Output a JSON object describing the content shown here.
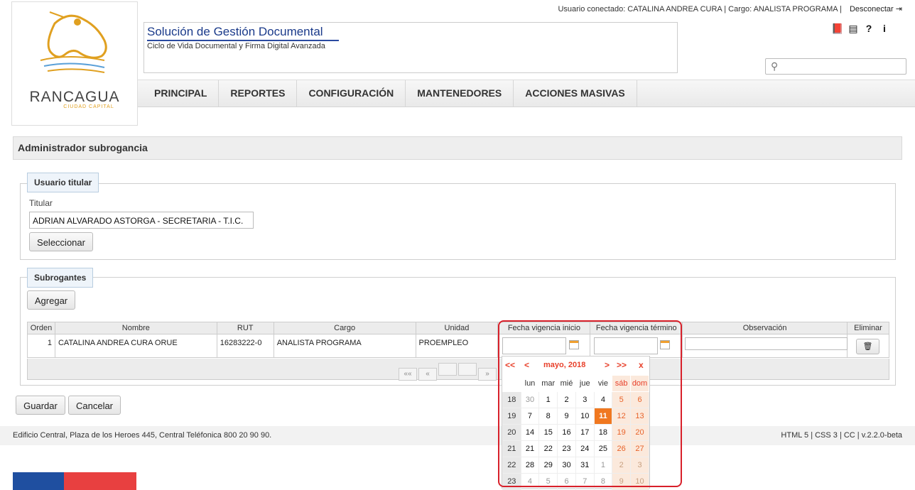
{
  "topbar": {
    "user_info": "Usuario conectado: CATALINA ANDREA CURA | Cargo: ANALISTA PROGRAMA |",
    "logout": "Desconectar"
  },
  "logo": {
    "name": "RANCAGUA",
    "subtitle": "CIUDAD CAPITAL"
  },
  "app": {
    "title": "Solución de Gestión Documental",
    "subtitle": "Ciclo de Vida Documental y Firma Digital Avanzada"
  },
  "toolbar_icons": [
    "book-icon",
    "newspaper-icon",
    "question-icon",
    "info-icon"
  ],
  "search": {
    "placeholder": ""
  },
  "nav": [
    "PRINCIPAL",
    "REPORTES",
    "CONFIGURACIÓN",
    "MANTENEDORES",
    "ACCIONES MASIVAS"
  ],
  "page_title": "Administrador subrogancia",
  "titular_section": {
    "legend": "Usuario titular",
    "label": "Titular",
    "value": "ADRIAN ALVARADO ASTORGA - SECRETARIA - T.I.C.",
    "select_button": "Seleccionar"
  },
  "subrogantes_section": {
    "legend": "Subrogantes",
    "add_button": "Agregar",
    "columns": [
      "Orden",
      "Nombre",
      "RUT",
      "Cargo",
      "Unidad",
      "Fecha vigencia inicio",
      "Fecha vigencia término",
      "Observación",
      "Eliminar"
    ],
    "rows": [
      {
        "orden": "1",
        "nombre": "CATALINA ANDREA CURA ORUE",
        "rut": "16283222-0",
        "cargo": "ANALISTA PROGRAMA",
        "unidad": "PROEMPLEO"
      }
    ],
    "pager": [
      "««",
      "«",
      "",
      "",
      "»"
    ]
  },
  "actions": {
    "save": "Guardar",
    "cancel": "Cancelar"
  },
  "footer": {
    "address": "Edificio Central, Plaza de los Heroes 445, Central Teléfonica 800 20 90 90.",
    "versions": "HTML 5 | CSS 3 | CC | v.2.2.0-beta"
  },
  "calendar": {
    "prev_year": "<<",
    "prev_month": "<",
    "title": "mayo, 2018",
    "next_month": ">",
    "next_year": ">>",
    "close": "x",
    "day_headers": [
      "lun",
      "mar",
      "mié",
      "jue",
      "vie",
      "sáb",
      "dom"
    ],
    "weeks": [
      {
        "week": "18",
        "days": [
          "30",
          "1",
          "2",
          "3",
          "4",
          "5",
          "6"
        ]
      },
      {
        "week": "19",
        "days": [
          "7",
          "8",
          "9",
          "10",
          "11",
          "12",
          "13"
        ]
      },
      {
        "week": "20",
        "days": [
          "14",
          "15",
          "16",
          "17",
          "18",
          "19",
          "20"
        ]
      },
      {
        "week": "21",
        "days": [
          "21",
          "22",
          "23",
          "24",
          "25",
          "26",
          "27"
        ]
      },
      {
        "week": "22",
        "days": [
          "28",
          "29",
          "30",
          "31",
          "1",
          "2",
          "3"
        ]
      },
      {
        "week": "23",
        "days": [
          "4",
          "5",
          "6",
          "7",
          "8",
          "9",
          "10"
        ]
      }
    ],
    "today": "11",
    "colors": {
      "accent": "#e8402a",
      "today_bg": "#f07820",
      "weekend_bg": "#fbe9dc"
    }
  },
  "colors": {
    "title_blue": "#1a3a8a",
    "highlight": "#d8202a",
    "flag_blue": "#1f4fa0",
    "flag_red": "#e84040"
  }
}
